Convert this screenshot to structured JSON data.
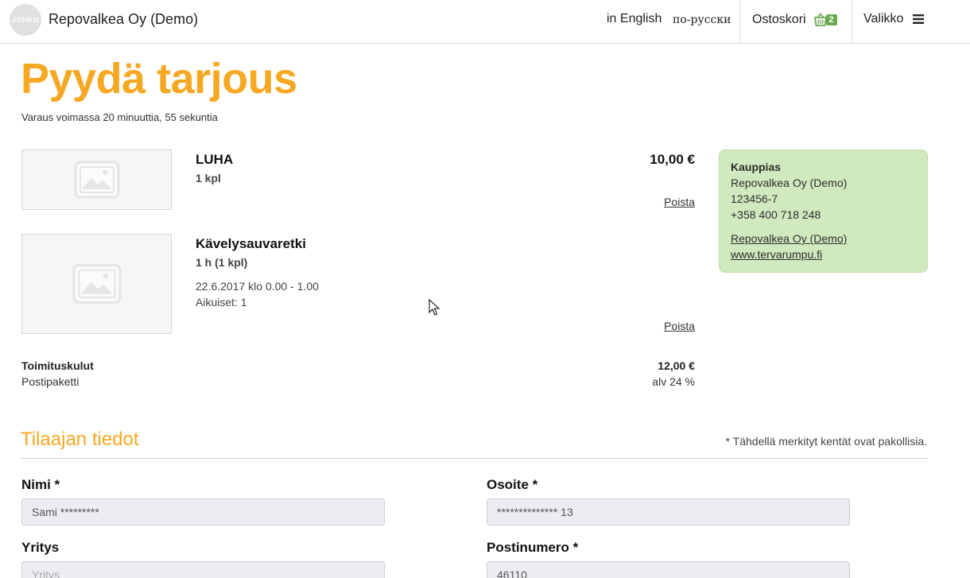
{
  "header": {
    "logo_text": "JOHKU",
    "site_name": "Repovalkea Oy (Demo)",
    "lang_english": "in English",
    "lang_russian": "по-русски",
    "cart_label": "Ostoskori",
    "cart_count": "2",
    "menu_label": "Valikko"
  },
  "page": {
    "title": "Pyydä tarjous",
    "reservation_note": "Varaus voimassa 20 minuuttia, 55 sekuntia"
  },
  "items": [
    {
      "name": "LUHA",
      "qty": "1 kpl",
      "price": "10,00 €",
      "remove_label": "Poista"
    },
    {
      "name": "Kävelysauvaretki",
      "qty": "1 h (1 kpl)",
      "date": "22.6.2017 klo 0.00 - 1.00",
      "guests": "Aikuiset: 1",
      "remove_label": "Poista"
    }
  ],
  "shipping": {
    "label": "Toimituskulut",
    "method": "Postipaketti",
    "price": "12,00 €",
    "vat": "alv 24 %"
  },
  "merchant": {
    "title": "Kauppias",
    "name": "Repovalkea Oy (Demo)",
    "business_id": "123456-7",
    "phone": "+358 400 718 248",
    "link_name": "Repovalkea Oy (Demo)",
    "website": "www.tervarumpu.fi"
  },
  "form": {
    "section_title": "Tilaajan tiedot",
    "required_note": "* Tähdellä merkityt kentät ovat pakollisia.",
    "name_label": "Nimi *",
    "name_value": "Sami *********",
    "address_label": "Osoite *",
    "address_value": "************** 13",
    "company_label": "Yritys",
    "company_placeholder": "Yritys",
    "postcode_label": "Postinumero *",
    "postcode_value": "46110"
  },
  "colors": {
    "accent": "#f7a823",
    "merchant_bg": "#d1e9bf",
    "cart_badge": "#6aa84f",
    "input_bg": "#ebedf0"
  },
  "icons": [
    "cart-basket-icon",
    "hamburger-menu-icon",
    "image-placeholder-icon",
    "mouse-pointer-icon"
  ]
}
